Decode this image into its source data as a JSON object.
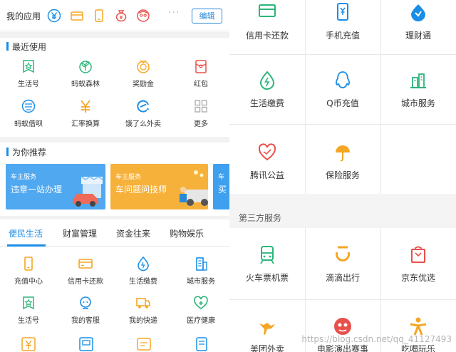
{
  "colors": {
    "accent": "#1a8ee6",
    "orange": "#f5a623",
    "green": "#2cb57a",
    "red": "#e8504a"
  },
  "topbar": {
    "my_apps_label": "我的应用",
    "quick_icons": [
      "yen-circle-icon",
      "card-icon",
      "phone-icon",
      "money-bag-icon",
      "avatar-icon"
    ],
    "more_dots": "···",
    "edit_label": "编辑"
  },
  "recent": {
    "heading": "最近使用",
    "items": [
      {
        "label": "生活号",
        "icon": "star-badge-icon"
      },
      {
        "label": "蚂蚁森林",
        "icon": "sprout-icon"
      },
      {
        "label": "奖励金",
        "icon": "coin-icon"
      },
      {
        "label": "红包",
        "icon": "red-packet-icon"
      },
      {
        "label": "蚂蚁借呗",
        "icon": "borrow-icon"
      },
      {
        "label": "汇率换算",
        "icon": "yen-icon"
      },
      {
        "label": "饿了么外卖",
        "icon": "eleme-icon"
      },
      {
        "label": "更多",
        "icon": "grid-more-icon"
      }
    ]
  },
  "recommend": {
    "heading": "为你推荐",
    "banners": [
      {
        "tag": "车主服务",
        "title": "违章一站办理"
      },
      {
        "tag": "车主服务",
        "title": "车问题问技师"
      },
      {
        "tag": "车",
        "title": "买"
      }
    ]
  },
  "tabs": [
    "便民生活",
    "财富管理",
    "资金往来",
    "购物娱乐"
  ],
  "services": {
    "items": [
      {
        "label": "充值中心",
        "icon": "phone-recharge-icon"
      },
      {
        "label": "信用卡还款",
        "icon": "credit-card-icon"
      },
      {
        "label": "生活缴费",
        "icon": "water-drop-icon"
      },
      {
        "label": "城市服务",
        "icon": "building-icon"
      },
      {
        "label": "生活号",
        "icon": "star-badge-icon"
      },
      {
        "label": "我的客服",
        "icon": "headset-icon"
      },
      {
        "label": "我的快递",
        "icon": "truck-icon"
      },
      {
        "label": "医疗健康",
        "icon": "heart-plus-icon"
      }
    ]
  },
  "right_grid": {
    "rows": [
      [
        {
          "label": "信用卡还款",
          "icon": "credit-card-icon"
        },
        {
          "label": "手机充值",
          "icon": "phone-yen-icon"
        },
        {
          "label": "理财通",
          "icon": "wealth-drop-icon"
        }
      ],
      [
        {
          "label": "生活缴费",
          "icon": "water-drop-icon"
        },
        {
          "label": "Q币充值",
          "icon": "qq-penguin-icon"
        },
        {
          "label": "城市服务",
          "icon": "city-icon"
        }
      ],
      [
        {
          "label": "腾讯公益",
          "icon": "charity-heart-icon"
        },
        {
          "label": "保险服务",
          "icon": "umbrella-icon"
        }
      ]
    ]
  },
  "third_party": {
    "heading": "第三方服务",
    "rows": [
      [
        {
          "label": "火车票机票",
          "icon": "train-icon"
        },
        {
          "label": "滴滴出行",
          "icon": "didi-icon"
        },
        {
          "label": "京东优选",
          "icon": "jd-bag-icon"
        }
      ],
      [
        {
          "label": "美团外卖",
          "icon": "kangaroo-icon"
        },
        {
          "label": "电影演出赛事",
          "icon": "movie-icon"
        },
        {
          "label": "吃喝玩乐",
          "icon": "person-fun-icon"
        }
      ]
    ]
  },
  "watermark": "https://blog.csdn.net/qq_41127493"
}
